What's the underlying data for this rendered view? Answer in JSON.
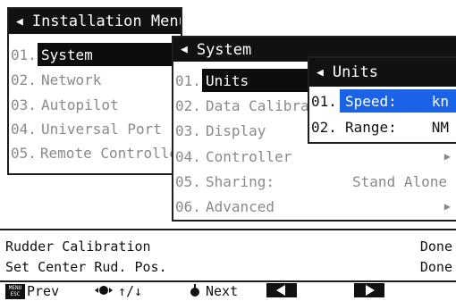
{
  "menu1": {
    "title": "Installation Menu",
    "items": [
      {
        "num": "01.",
        "label": "System"
      },
      {
        "num": "02.",
        "label": "Network"
      },
      {
        "num": "03.",
        "label": "Autopilot"
      },
      {
        "num": "04.",
        "label": "Universal Port"
      },
      {
        "num": "05.",
        "label": "Remote Controller"
      }
    ]
  },
  "menu2": {
    "title": "System",
    "items": [
      {
        "num": "01.",
        "label": "Units"
      },
      {
        "num": "02.",
        "label": "Data Calibration"
      },
      {
        "num": "03.",
        "label": "Display"
      },
      {
        "num": "04.",
        "label": "Controller"
      },
      {
        "num": "05.",
        "label": "Sharing:",
        "value": "Stand Alone"
      },
      {
        "num": "06.",
        "label": "Advanced"
      }
    ]
  },
  "menu3": {
    "title": "Units",
    "items": [
      {
        "num": "01.",
        "label": "Speed:",
        "value": "kn"
      },
      {
        "num": "02.",
        "label": "Range:",
        "value": "NM"
      }
    ]
  },
  "status": {
    "rudder_calibration": "Rudder Calibration",
    "rudder_calibration_value": "Done",
    "set_center": "Set Center Rud. Pos.",
    "set_center_value": "Done"
  },
  "footer": {
    "menu_esc_top": "MENU",
    "menu_esc_bottom": "ESC",
    "prev": "Prev",
    "arrows": "↑/↓",
    "next": "Next"
  },
  "colors": {
    "highlight": "#0d0d0d",
    "dim_text": "#8a8a8a",
    "units_selected": "#1a62e6"
  }
}
